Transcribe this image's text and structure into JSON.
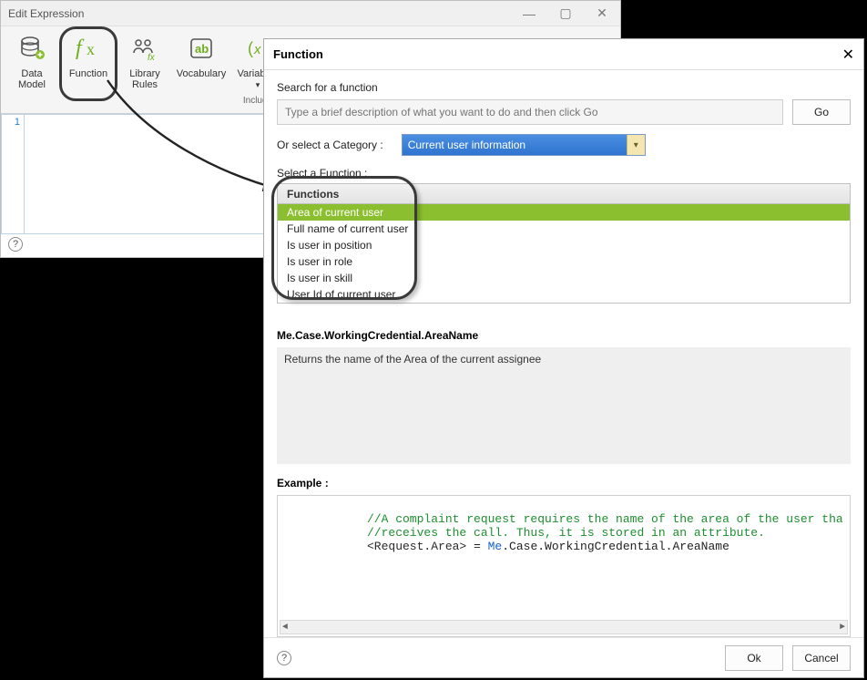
{
  "edit_window": {
    "title": "Edit Expression",
    "ribbon": {
      "data_model": {
        "label_l1": "Data",
        "label_l2": "Model"
      },
      "function": {
        "label": "Function"
      },
      "library": {
        "label_l1": "Library",
        "label_l2": "Rules"
      },
      "vocabulary": {
        "label": "Vocabulary"
      },
      "variables": {
        "label_l1": "Variables",
        "label_l2": "▾",
        "sublabel": "Include"
      }
    },
    "gutter_line": "1"
  },
  "function_dialog": {
    "title": "Function",
    "search_label": "Search for a function",
    "search_placeholder": "Type a brief description of what you want to do and then click Go",
    "go_label": "Go",
    "category_label": "Or select a Category :",
    "category_value": "Current user information",
    "select_func_label": "Select a Function :",
    "functions_header": "Functions",
    "functions": [
      "Area of current user",
      "Full name of current user",
      "Is user in position",
      "Is user in role",
      "Is user in skill",
      "User Id of current user"
    ],
    "signature": "Me.Case.WorkingCredential.AreaName",
    "description": "Returns the name of the Area of the current assignee",
    "example_label": "Example :",
    "example": {
      "comment1": "//A complaint request requires the name of the area of the user tha",
      "comment2": "//receives the call. Thus, it is stored in an attribute.",
      "lhs": "<Request.Area>",
      "eq": " = ",
      "me": "Me",
      "rest": ".Case.WorkingCredential.AreaName"
    },
    "ok_label": "Ok",
    "cancel_label": "Cancel"
  }
}
